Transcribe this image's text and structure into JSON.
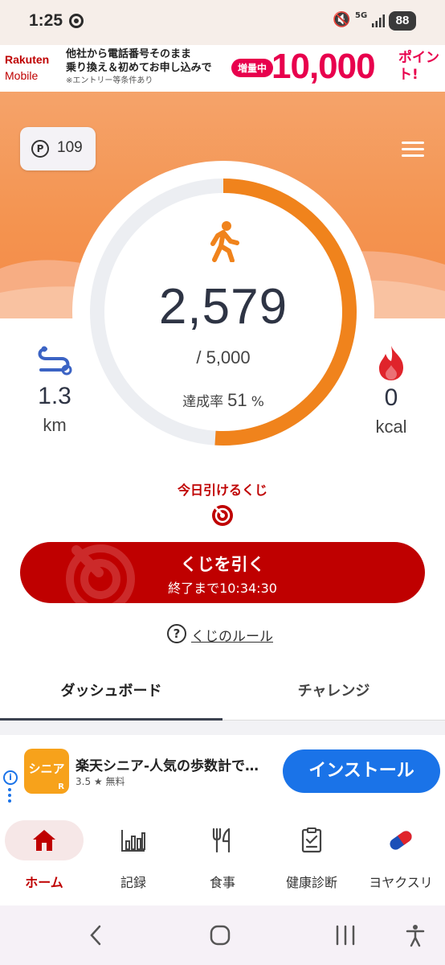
{
  "status_bar": {
    "time": "1:25",
    "network": "5G",
    "battery": "88",
    "icons": [
      "app-notification-icon",
      "mute-icon",
      "5g-icon",
      "signal-icon",
      "battery-icon"
    ]
  },
  "ad_banner": {
    "logo_line1": "Rakuten",
    "logo_line2": "Mobile",
    "line1": "他社から電話番号そのまま",
    "line2": "乗り換え＆初めてお申し込みで",
    "note": "※エントリー等条件あり",
    "pill": "増量中",
    "amount": "10,000",
    "unit": "ポイント!"
  },
  "points": {
    "value": "109",
    "icon": "P"
  },
  "progress": {
    "steps": "2,579",
    "goal": "/ 5,000",
    "rate_label": "達成率",
    "rate_value": "51",
    "rate_unit": "%",
    "fraction": 0.51
  },
  "distance": {
    "value": "1.3",
    "unit": "km"
  },
  "calories": {
    "value": "0",
    "unit": "kcal"
  },
  "lottery": {
    "title": "今日引けるくじ",
    "button_label": "くじを引く",
    "button_sub": "終了まで10:34:30",
    "rules_icon": "?",
    "rules_link": "くじのルール"
  },
  "tabs": [
    {
      "label": "ダッシュボード",
      "active": true
    },
    {
      "label": "チャレンジ",
      "active": false
    }
  ],
  "app_ad": {
    "info_icon": "i",
    "icon_text": "シニア",
    "icon_badge": "R",
    "title": "楽天シニア-人気の歩数計で…",
    "rating": "3.5 ★ 無料",
    "install": "インストール"
  },
  "bottom_nav": [
    {
      "label": "ホーム",
      "icon": "home-icon",
      "active": true
    },
    {
      "label": "記録",
      "icon": "chart-icon",
      "active": false
    },
    {
      "label": "食事",
      "icon": "meal-icon",
      "active": false
    },
    {
      "label": "健康診断",
      "icon": "checkup-icon",
      "active": false
    },
    {
      "label": "ヨヤクスリ",
      "icon": "pill-icon",
      "active": false
    }
  ],
  "colors": {
    "accent": "#f0831c",
    "brand_red": "#bf0000",
    "header_orange": "#f4934f",
    "text_dark": "#2e3444",
    "install_blue": "#1a73e8"
  }
}
